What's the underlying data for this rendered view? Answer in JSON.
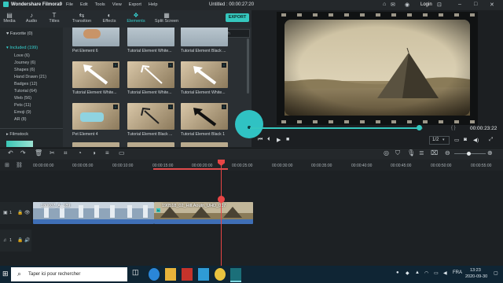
{
  "titlebar": {
    "app_name": "Wondershare Filmora9",
    "menu": [
      "File",
      "Edit",
      "Tools",
      "View",
      "Export",
      "Help"
    ],
    "window_title": "Untitled : 00:00:27:20",
    "login": "Login"
  },
  "tool_tabs": [
    {
      "label": "Media",
      "icon": "media-icon"
    },
    {
      "label": "Audio",
      "icon": "music-note-icon"
    },
    {
      "label": "Titles",
      "icon": "text-icon"
    },
    {
      "label": "Transition",
      "icon": "transition-icon"
    },
    {
      "label": "Effects",
      "icon": "effects-icon"
    },
    {
      "label": "Elements",
      "icon": "elements-icon"
    },
    {
      "label": "Split Screen",
      "icon": "split-screen-icon"
    }
  ],
  "export_label": "EXPORT",
  "sidebar": {
    "favorite": "Favorite (0)",
    "included": "Included (199)",
    "subcategories": [
      "Love (6)",
      "Journey (6)",
      "Shapes (6)",
      "Hand Drawn (21)",
      "Badges (12)",
      "Tutorial (64)",
      "Web (56)",
      "Pets (11)",
      "Emoji (9)",
      "AR (8)"
    ],
    "filmstock": "Filmstock"
  },
  "elements_search_placeholder": "Search",
  "elements": [
    {
      "label": "Pet Element 6"
    },
    {
      "label": "Tutorial Element White..."
    },
    {
      "label": "Tutorial Element Black ..."
    },
    {
      "label": "Tutorial Element White..."
    },
    {
      "label": "Tutorial Element White..."
    },
    {
      "label": "Tutorial Element White..."
    },
    {
      "label": "Pet Element 4"
    },
    {
      "label": "Tutorial Element Black ..."
    },
    {
      "label": "Tutorial Element Black 1"
    }
  ],
  "preview": {
    "timecode": "00:00:23:22",
    "quality": "1/2",
    "progress": 0.97
  },
  "timeline": {
    "ruler": [
      "00:00:00:00",
      "00:00:05:00",
      "00:00:10:00",
      "00:00:15:00",
      "00:00:20:00",
      "00:00:25:00",
      "00:00:30:00",
      "00:00:35:00",
      "00:00:40:00",
      "00:00:45:00",
      "00:00:50:00",
      "00:00:55:00"
    ],
    "video_track": "1",
    "audio_track": "1",
    "clips": [
      {
        "label": "180607_A_189"
      },
      {
        "label": "190518_02_Hill.Aoutn_UHD_007"
      }
    ]
  },
  "taskbar": {
    "search_placeholder": "Taper ici pour rechercher",
    "lang": "FRA",
    "time": "13:23",
    "date": "2020-09-30"
  },
  "colors": {
    "accent": "#35c7be",
    "playhead": "#e84545"
  }
}
